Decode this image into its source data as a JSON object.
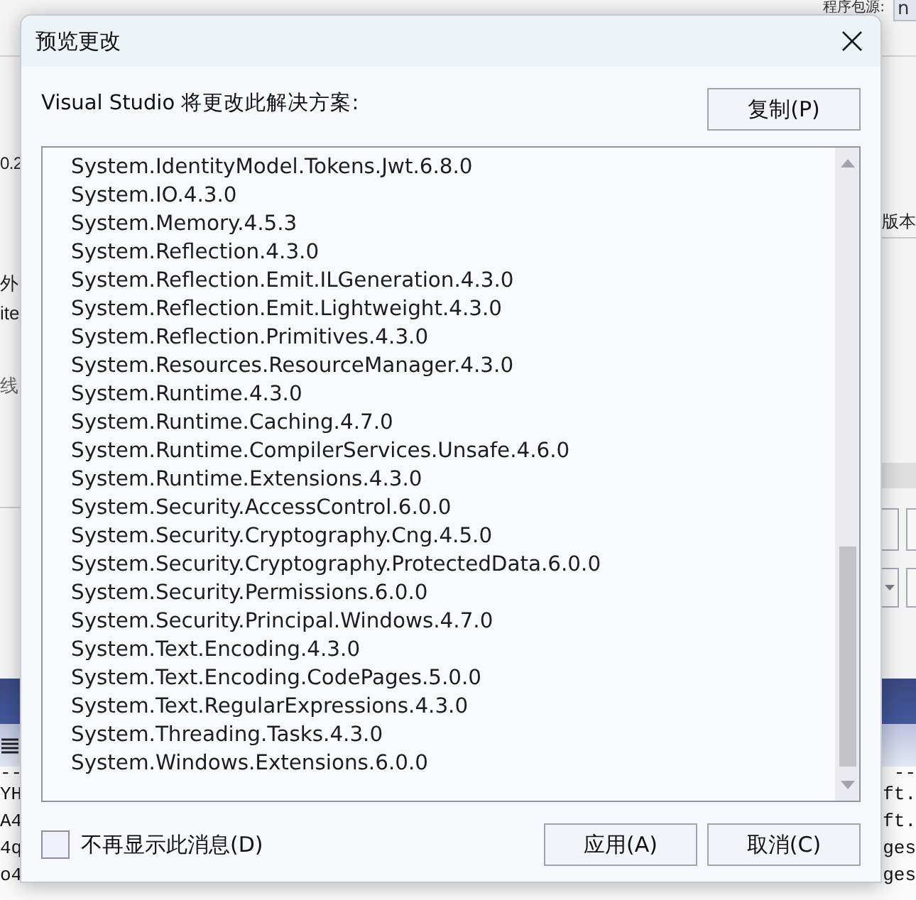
{
  "background_window": {
    "package_source": {
      "label": "程序包源:",
      "value": "n"
    },
    "left_texts": [
      "0.2",
      "外",
      "ite",
      "线"
    ],
    "column_header": "版本",
    "console_lines": [
      {
        "left": "--",
        "right": "--"
      },
      {
        "left": "YH",
        "right": "ft."
      },
      {
        "left": "A4",
        "right": "ft."
      },
      {
        "left": "4q",
        "right": "ges"
      },
      {
        "left": "o4",
        "right": "ges"
      }
    ]
  },
  "dialog": {
    "title": "预览更改",
    "message": "Visual Studio 将更改此解决方案:",
    "copy_button": "复制(P)",
    "changes": [
      "System.IdentityModel.Tokens.Jwt.6.8.0",
      "System.IO.4.3.0",
      "System.Memory.4.5.3",
      "System.Reflection.4.3.0",
      "System.Reflection.Emit.ILGeneration.4.3.0",
      "System.Reflection.Emit.Lightweight.4.3.0",
      "System.Reflection.Primitives.4.3.0",
      "System.Resources.ResourceManager.4.3.0",
      "System.Runtime.4.3.0",
      "System.Runtime.Caching.4.7.0",
      "System.Runtime.CompilerServices.Unsafe.4.6.0",
      "System.Runtime.Extensions.4.3.0",
      "System.Security.AccessControl.6.0.0",
      "System.Security.Cryptography.Cng.4.5.0",
      "System.Security.Cryptography.ProtectedData.6.0.0",
      "System.Security.Permissions.6.0.0",
      "System.Security.Principal.Windows.4.7.0",
      "System.Text.Encoding.4.3.0",
      "System.Text.Encoding.CodePages.5.0.0",
      "System.Text.RegularExpressions.4.3.0",
      "System.Threading.Tasks.4.3.0",
      "System.Windows.Extensions.6.0.0"
    ],
    "dont_show_again": {
      "label": "不再显示此消息(D)",
      "checked": false
    },
    "buttons": [
      "应用(A)",
      "取消(C)"
    ]
  }
}
